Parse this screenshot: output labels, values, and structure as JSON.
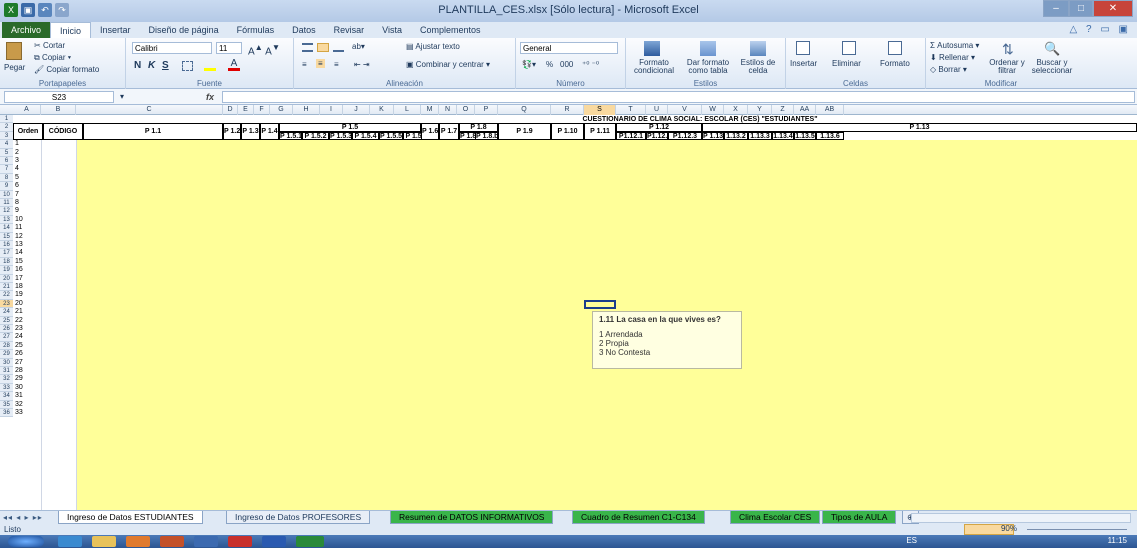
{
  "window": {
    "title": "PLANTILLA_CES.xlsx [Sólo lectura] - Microsoft Excel"
  },
  "tabs": [
    "Archivo",
    "Inicio",
    "Insertar",
    "Diseño de página",
    "Fórmulas",
    "Datos",
    "Revisar",
    "Vista",
    "Complementos"
  ],
  "ribbon": {
    "clipboard": {
      "paste": "Pegar",
      "cut": "Cortar",
      "copy": "Copiar",
      "format_painter": "Copiar formato",
      "label": "Portapapeles"
    },
    "font": {
      "name": "Calibri",
      "size": "11",
      "label": "Fuente",
      "bold": "N",
      "italic": "K",
      "underline": "S"
    },
    "alignment": {
      "wrap": "Ajustar texto",
      "merge": "Combinar y centrar",
      "label": "Alineación"
    },
    "number": {
      "format": "General",
      "percent": "%",
      "thousands": "000",
      "label": "Número"
    },
    "styles": {
      "conditional": "Formato condicional",
      "table": "Dar formato como tabla",
      "cell_styles": "Estilos de celda",
      "label": "Estilos"
    },
    "cells": {
      "insert": "Insertar",
      "delete": "Eliminar",
      "format": "Formato",
      "label": "Celdas"
    },
    "editing": {
      "autosum": "Autosuma",
      "fill": "Rellenar",
      "clear": "Borrar",
      "sort": "Ordenar y filtrar",
      "find": "Buscar y seleccionar",
      "label": "Modificar"
    }
  },
  "formula_bar": {
    "name_box": "S23",
    "fx": "fx",
    "value": ""
  },
  "columns": [
    "A",
    "B",
    "C",
    "D",
    "E",
    "F",
    "G",
    "H",
    "I",
    "J",
    "K",
    "L",
    "M",
    "N",
    "O",
    "P",
    "Q",
    "R",
    "S",
    "T",
    "U",
    "V",
    "W",
    "X",
    "Y",
    "Z",
    "AA",
    "AB"
  ],
  "rows": [
    "1",
    "2",
    "3",
    "4",
    "5",
    "6",
    "7",
    "8",
    "9",
    "10",
    "11",
    "12",
    "13",
    "14",
    "15",
    "16",
    "17",
    "18",
    "19",
    "20",
    "21",
    "22",
    "23",
    "24",
    "25",
    "26",
    "27",
    "28",
    "29",
    "30",
    "31",
    "32",
    "33",
    "34",
    "35",
    "36"
  ],
  "sheet": {
    "title": "CUESTIONARIO DE CLIMA SOCIAL: ESCOLAR (CES) \"ESTUDIANTES\"",
    "headers": {
      "orden": "Orden",
      "codigo": "CÓDIGO",
      "p11": "P 1.1",
      "p12": "P 1.2",
      "p13": "P 1.3",
      "p14": "P 1.4",
      "p15": "P 1.5",
      "p15_sub": [
        "P 1.5.1",
        "P 1.5.2",
        "P 1.5.3",
        "P 1.5.4",
        "P 1.5.5",
        "P 1.5.6"
      ],
      "p16": "P 1.6",
      "p17": "P 1.7",
      "p18": "P 1.8",
      "p18_sub": [
        "P 1.8.a",
        "P 1.8.b"
      ],
      "p19": "P 1.9",
      "p110": "P 1.10",
      "p111": "P 1.11",
      "p112": "P 1.12",
      "p112_sub": [
        "P1.12.1",
        "P1.12.2",
        "P1.12.3"
      ],
      "p113": "P 1.13",
      "p113_sub": [
        "P 1.13.1",
        "1.13.2",
        "1.13.3",
        "1.13.4",
        "1.13.5",
        "1.13.6"
      ]
    },
    "orden_values": [
      "1",
      "2",
      "3",
      "4",
      "5",
      "6",
      "7",
      "8",
      "9",
      "10",
      "11",
      "12",
      "13",
      "14",
      "15",
      "16",
      "17",
      "18",
      "19",
      "20",
      "21",
      "22",
      "23",
      "24",
      "25",
      "26",
      "27",
      "28",
      "29",
      "30",
      "31",
      "32",
      "33"
    ]
  },
  "comment": {
    "title": "1.11 La casa en la que vives es?",
    "options": [
      "1 Arrendada",
      "2 Propia",
      "3 No Contesta"
    ]
  },
  "sheet_tabs": [
    "Ingreso de Datos ESTUDIANTES",
    "Ingreso de Datos PROFESORES",
    "Resumen de DATOS INFORMATIVOS",
    "Cuadro de Resumen C1-C134",
    "Clima Escolar CES",
    "Tipos de AULA"
  ],
  "status": {
    "ready": "Listo",
    "zoom": "90%"
  },
  "taskbar": {
    "lang": "ES",
    "time": "11:15"
  },
  "colors": {
    "yellow_fill": "#ffff99",
    "selection_header": "#f9d99f",
    "file_tab": "#2a6a2a",
    "green_tab": "#39b54a"
  }
}
